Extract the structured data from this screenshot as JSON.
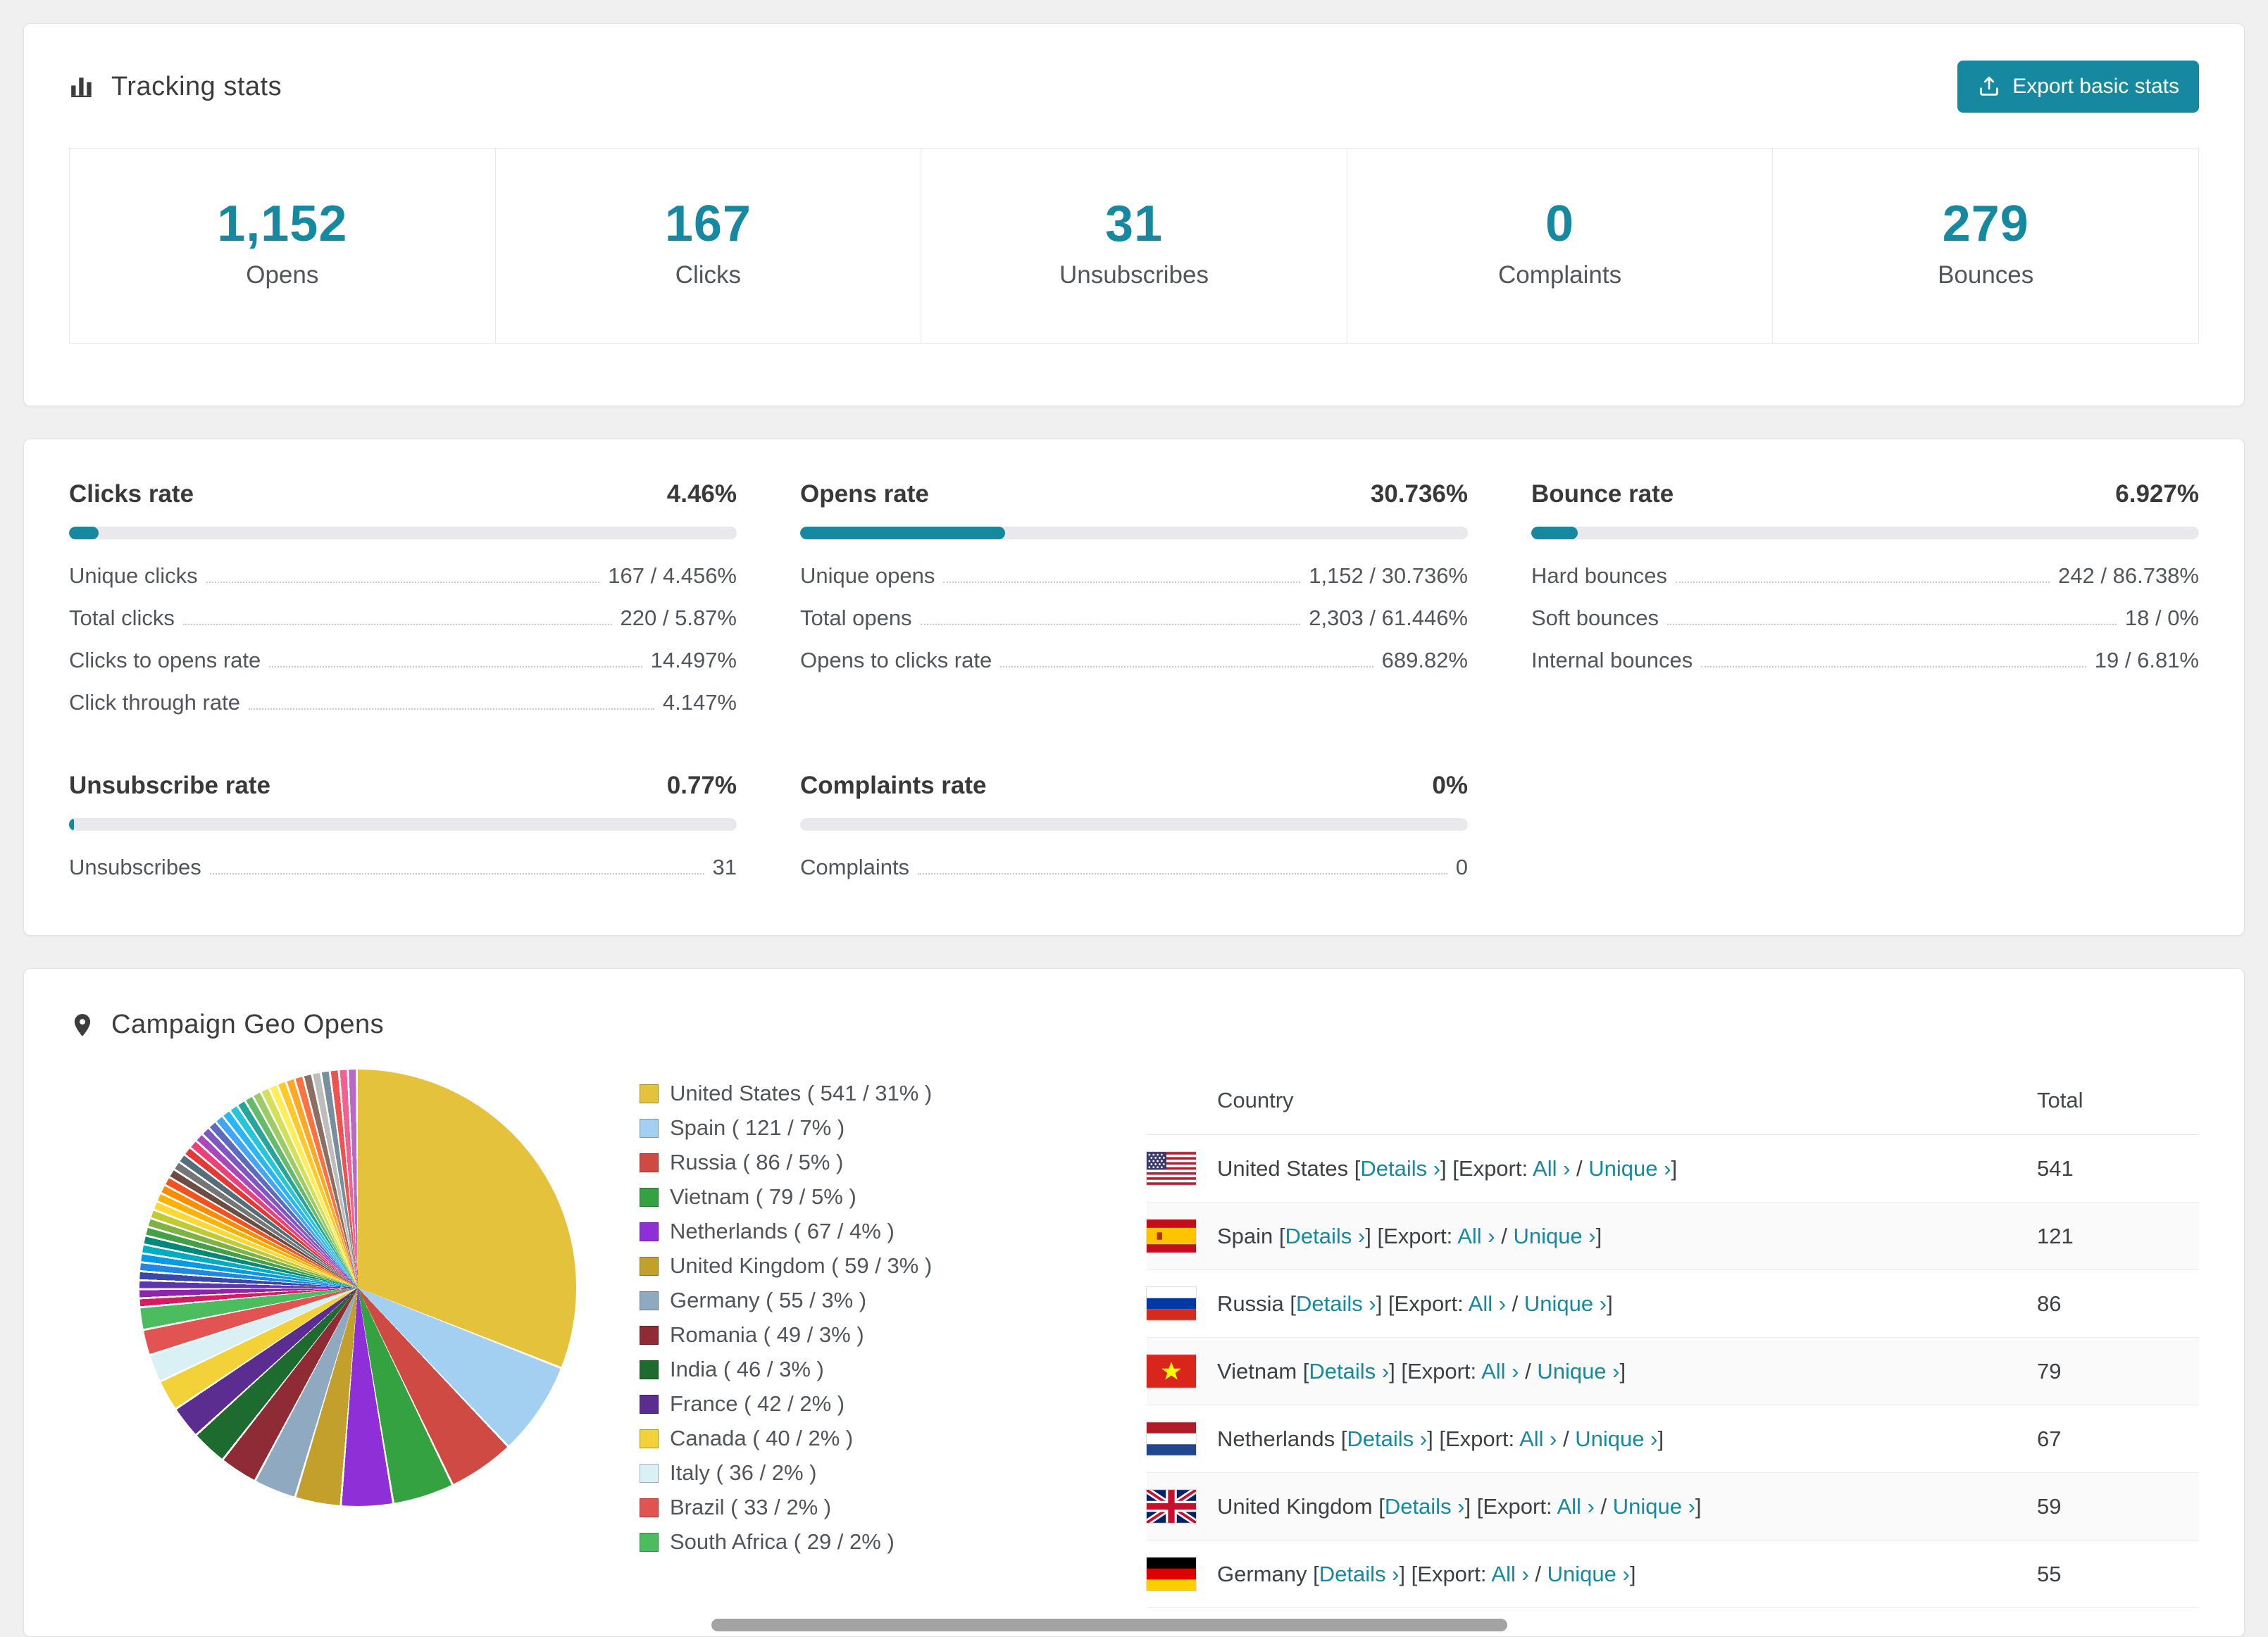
{
  "colors": {
    "accent": "#1688a0",
    "bar_track": "#e9e9ed"
  },
  "tracking": {
    "title": "Tracking stats",
    "export_button_label": "Export basic stats",
    "stats": [
      {
        "value": "1,152",
        "label": "Opens"
      },
      {
        "value": "167",
        "label": "Clicks"
      },
      {
        "value": "31",
        "label": "Unsubscribes"
      },
      {
        "value": "0",
        "label": "Complaints"
      },
      {
        "value": "279",
        "label": "Bounces"
      }
    ]
  },
  "rates": [
    {
      "title": "Clicks rate",
      "display": "4.46%",
      "percent": 4.46,
      "rows": [
        {
          "label": "Unique clicks",
          "value": "167 / 4.456%"
        },
        {
          "label": "Total clicks",
          "value": "220 / 5.87%"
        },
        {
          "label": "Clicks to opens rate",
          "value": "14.497%"
        },
        {
          "label": "Click through rate",
          "value": "4.147%"
        }
      ]
    },
    {
      "title": "Opens rate",
      "display": "30.736%",
      "percent": 30.736,
      "rows": [
        {
          "label": "Unique opens",
          "value": "1,152 / 30.736%"
        },
        {
          "label": "Total opens",
          "value": "2,303 / 61.446%"
        },
        {
          "label": "Opens to clicks rate",
          "value": "689.82%"
        }
      ]
    },
    {
      "title": "Bounce rate",
      "display": "6.927%",
      "percent": 6.927,
      "rows": [
        {
          "label": "Hard bounces",
          "value": "242 / 86.738%"
        },
        {
          "label": "Soft bounces",
          "value": "18 / 0%"
        },
        {
          "label": "Internal bounces",
          "value": "19 / 6.81%"
        }
      ]
    },
    {
      "title": "Unsubscribe rate",
      "display": "0.77%",
      "percent": 0.77,
      "rows": [
        {
          "label": "Unsubscribes",
          "value": "31"
        }
      ]
    },
    {
      "title": "Complaints rate",
      "display": "0%",
      "percent": 0,
      "rows": [
        {
          "label": "Complaints",
          "value": "0"
        }
      ]
    }
  ],
  "geo": {
    "title": "Campaign Geo Opens",
    "table": {
      "country_header": "Country",
      "total_header": "Total",
      "details_label": "Details ›",
      "export_label": "Export:",
      "all_label": "All ›",
      "unique_label": "Unique ›",
      "rows": [
        {
          "flag": "us",
          "country": "United States",
          "total": "541"
        },
        {
          "flag": "es",
          "country": "Spain",
          "total": "121"
        },
        {
          "flag": "ru",
          "country": "Russia",
          "total": "86"
        },
        {
          "flag": "vn",
          "country": "Vietnam",
          "total": "79"
        },
        {
          "flag": "nl",
          "country": "Netherlands",
          "total": "67"
        },
        {
          "flag": "gb",
          "country": "United Kingdom",
          "total": "59"
        },
        {
          "flag": "de",
          "country": "Germany",
          "total": "55"
        }
      ]
    }
  },
  "chart_data": {
    "type": "pie",
    "title": "Campaign Geo Opens",
    "legend_position": "right",
    "slices": [
      {
        "label": "United States",
        "value": 541,
        "pct": "31%",
        "color": "#e5c23c"
      },
      {
        "label": "Spain",
        "value": 121,
        "pct": "7%",
        "color": "#a3d0f1"
      },
      {
        "label": "Russia",
        "value": 86,
        "pct": "5%",
        "color": "#cf4a42"
      },
      {
        "label": "Vietnam",
        "value": 79,
        "pct": "5%",
        "color": "#34a241"
      },
      {
        "label": "Netherlands",
        "value": 67,
        "pct": "4%",
        "color": "#8e2fd8"
      },
      {
        "label": "United Kingdom",
        "value": 59,
        "pct": "3%",
        "color": "#c3a02b"
      },
      {
        "label": "Germany",
        "value": 55,
        "pct": "3%",
        "color": "#8fa9c0"
      },
      {
        "label": "Romania",
        "value": 49,
        "pct": "3%",
        "color": "#8e2b34"
      },
      {
        "label": "India",
        "value": 46,
        "pct": "3%",
        "color": "#1e6b2f"
      },
      {
        "label": "France",
        "value": 42,
        "pct": "2%",
        "color": "#5b2d91"
      },
      {
        "label": "Canada",
        "value": 40,
        "pct": "2%",
        "color": "#f2d139"
      },
      {
        "label": "Italy",
        "value": 36,
        "pct": "2%",
        "color": "#d9f1f4"
      },
      {
        "label": "Brazil",
        "value": 33,
        "pct": "2%",
        "color": "#e25452"
      },
      {
        "label": "South Africa",
        "value": 29,
        "pct": "2%",
        "color": "#4cbd5e"
      }
    ],
    "others": {
      "total": 459,
      "colors": [
        "#d81b60",
        "#8e24aa",
        "#5e35b1",
        "#3949ab",
        "#1e88e5",
        "#039be5",
        "#00acc1",
        "#00897b",
        "#43a047",
        "#7cb342",
        "#c0ca33",
        "#fdd835",
        "#ffb300",
        "#fb8c00",
        "#f4511e",
        "#6d4c41",
        "#757575",
        "#546e7a",
        "#e53935",
        "#ec407a",
        "#ab47bc",
        "#7e57c2",
        "#5c6bc0",
        "#42a5f5",
        "#29b6f6",
        "#26c6da",
        "#26a69a",
        "#66bb6a",
        "#9ccc65",
        "#d4e157",
        "#ffee58",
        "#ffca28",
        "#ffa726",
        "#ff7043",
        "#8d6e63",
        "#bdbdbd",
        "#78909c",
        "#ef5350",
        "#f06292",
        "#ba68c8"
      ]
    }
  }
}
